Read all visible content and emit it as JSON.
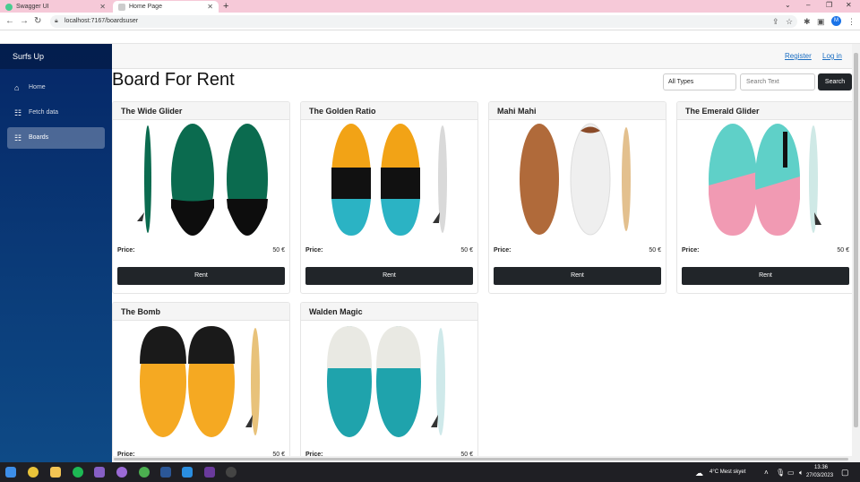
{
  "browser": {
    "tabs": [
      {
        "title": "Swagger UI",
        "active": false
      },
      {
        "title": "Home Page",
        "active": true
      }
    ],
    "url": "localhost:7167/boardsuser"
  },
  "sidebar": {
    "brand": "Surfs Up",
    "items": [
      {
        "label": "Home",
        "icon": "home-icon",
        "active": false
      },
      {
        "label": "Fetch data",
        "icon": "list-icon",
        "active": false
      },
      {
        "label": "Boards",
        "icon": "list-icon",
        "active": true
      }
    ]
  },
  "header": {
    "register": "Register",
    "login": "Log in"
  },
  "page": {
    "title": "Board For Rent",
    "type_select": "All Types",
    "search_placeholder": "Search Text",
    "search_button": "Search"
  },
  "boards": [
    {
      "name": "The Wide Glider",
      "price_label": "Price:",
      "price": "50 €",
      "button": "Rent",
      "colors": [
        "#0b6b4f",
        "#0d0d0d"
      ]
    },
    {
      "name": "The Golden Ratio",
      "price_label": "Price:",
      "price": "50 €",
      "button": "Rent",
      "colors": [
        "#f2a316",
        "#111111",
        "#2bb3c4"
      ]
    },
    {
      "name": "Mahi Mahi",
      "price_label": "Price:",
      "price": "50 €",
      "button": "Rent",
      "colors": [
        "#b06a3a",
        "#efefef"
      ]
    },
    {
      "name": "The Emerald Glider",
      "price_label": "Price:",
      "price": "50 €",
      "button": "Rent",
      "colors": [
        "#5fd0c8",
        "#f19ab3"
      ]
    },
    {
      "name": "The Bomb",
      "price_label": "Price:",
      "price": "50 €",
      "button": "Rent",
      "colors": [
        "#1a1a1a",
        "#f5a922"
      ]
    },
    {
      "name": "Walden Magic",
      "price_label": "Price:",
      "price": "50 €",
      "button": "Rent",
      "colors": [
        "#e9e9e3",
        "#1fa3ac"
      ]
    }
  ],
  "taskbar": {
    "weather": "4°C  Mest skyet",
    "time": "13.36",
    "date": "27/03/2023"
  }
}
